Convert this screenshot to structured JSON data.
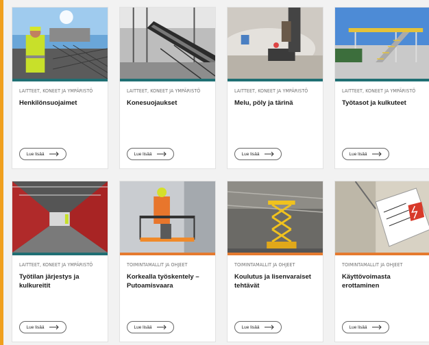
{
  "cards": [
    {
      "category": "LAITTEET, KONEET JA YMPÄRISTÖ",
      "title": "Henkilönsuojaimet",
      "button": "Lue lisää",
      "band": "teal"
    },
    {
      "category": "LAITTEET, KONEET JA YMPÄRISTÖ",
      "title": "Konesuojaukset",
      "button": "Lue lisää",
      "band": "teal"
    },
    {
      "category": "LAITTEET, KONEET JA YMPÄRISTÖ",
      "title": "Melu, pöly ja tärinä",
      "button": "Lue lisää",
      "band": "teal"
    },
    {
      "category": "LAITTEET, KONEET JA YMPÄRISTÖ",
      "title": "Työtasot ja kulkuteet",
      "button": "Lue lisää",
      "band": "teal"
    },
    {
      "category": "LAITTEET, KONEET JA YMPÄRISTÖ",
      "title": "Työtilan järjestys ja kulkureitit",
      "button": "Lue lisää",
      "band": "teal"
    },
    {
      "category": "TOIMINTAMALLIT JA OHJEET",
      "title": "Korkealla työskentely – Putoamisvaara",
      "button": "Lue lisää",
      "band": "orange"
    },
    {
      "category": "TOIMINTAMALLIT JA OHJEET",
      "title": "Koulutus ja lisenvaraiset tehtävät",
      "button": "Lue lisää",
      "band": "orange"
    },
    {
      "category": "TOIMINTAMALLIT JA OHJEET",
      "title": "Käyttövoimasta erottaminen",
      "button": "Lue lisää",
      "band": "orange"
    }
  ],
  "colors": {
    "accent": "#f0a01e",
    "teal": "#1f6f73",
    "orange": "#e57a2f"
  }
}
